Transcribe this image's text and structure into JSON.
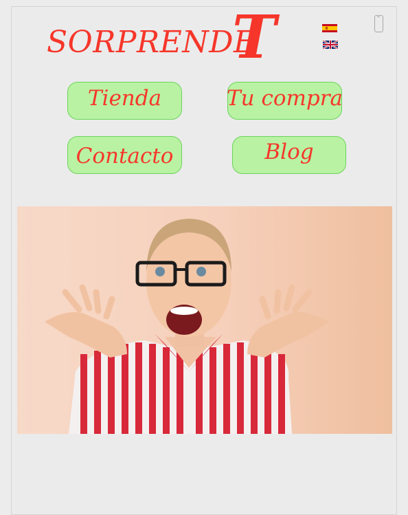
{
  "header": {
    "logo_text": "SORPRENDE",
    "logo_accent": "T",
    "languages": [
      {
        "code": "es",
        "flag": "spain-flag-icon"
      },
      {
        "code": "en",
        "flag": "uk-flag-icon"
      }
    ],
    "device_icon": "mobile-phone-icon"
  },
  "nav": {
    "items": [
      {
        "label": "Tienda"
      },
      {
        "label": "Tu compra"
      },
      {
        "label": "Contacto"
      },
      {
        "label": "Blog"
      }
    ]
  },
  "hero": {
    "image": "surprised-woman-photo"
  },
  "colors": {
    "brand_red": "#f6362a",
    "button_green": "#b9f2a3",
    "button_border": "#6bd35a",
    "page_bg": "#ececec"
  }
}
